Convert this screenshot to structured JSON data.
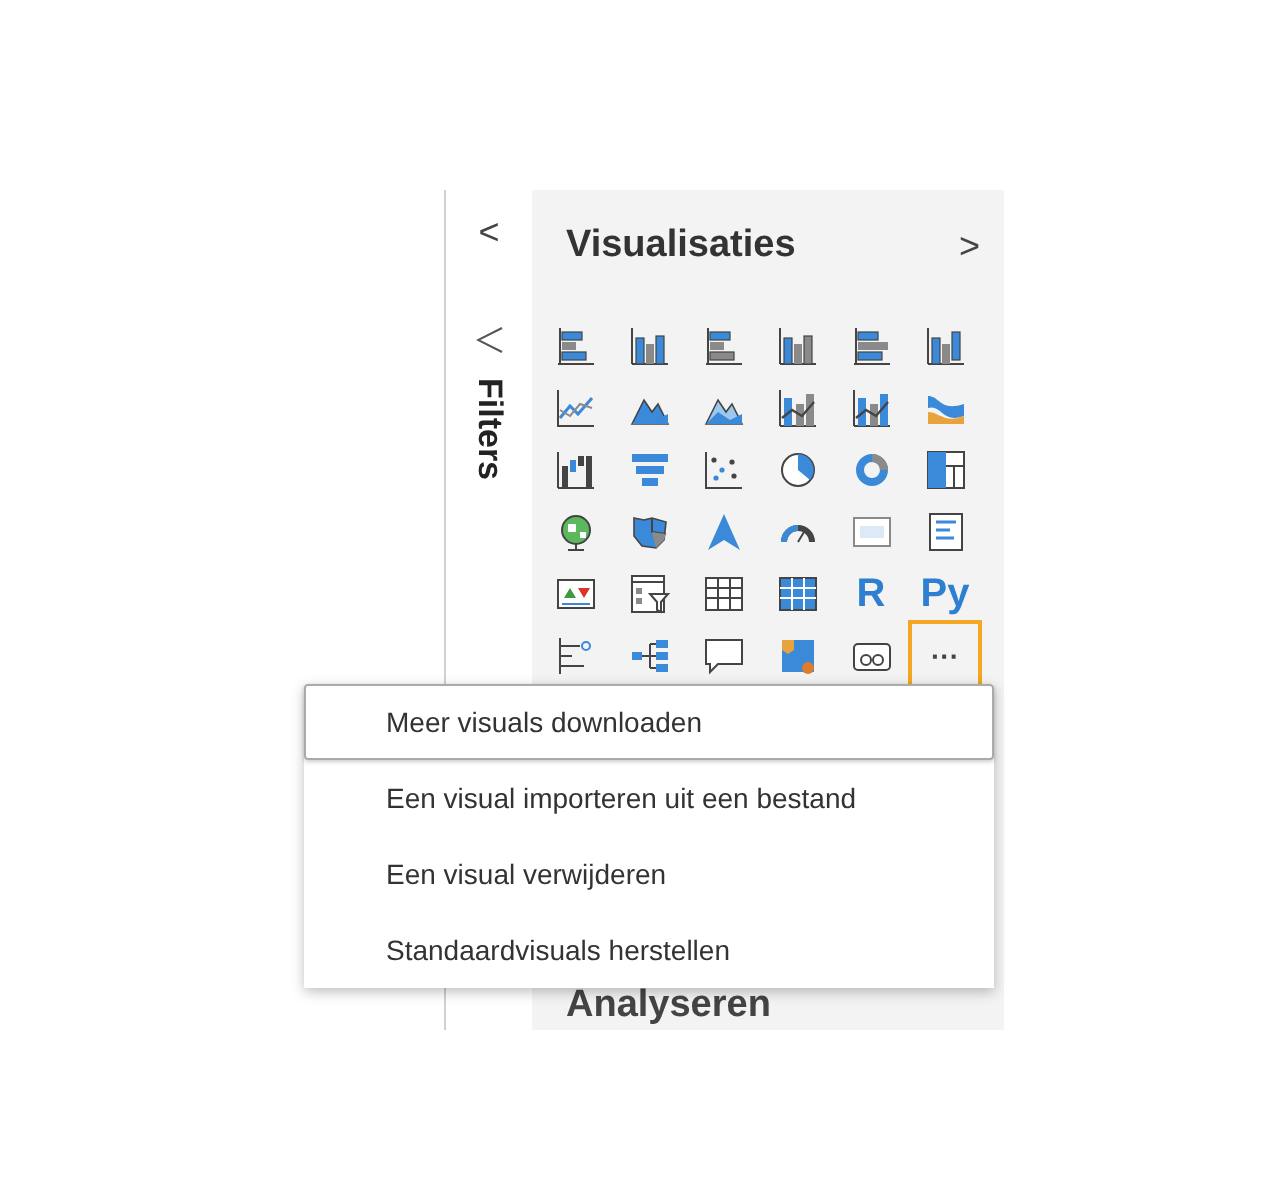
{
  "filters_strip": {
    "collapse_glyph": "<",
    "label": "Filters"
  },
  "visualizations": {
    "title": "Visualisaties",
    "expand_glyph": ">",
    "items": [
      {
        "kind": "hbar-stacked",
        "selected": false
      },
      {
        "kind": "column-stacked",
        "selected": false
      },
      {
        "kind": "hbar-clustered",
        "selected": false
      },
      {
        "kind": "column-clustered",
        "selected": false
      },
      {
        "kind": "hbar-full",
        "selected": false
      },
      {
        "kind": "column-full",
        "selected": false
      },
      {
        "kind": "line",
        "selected": false
      },
      {
        "kind": "area",
        "selected": false
      },
      {
        "kind": "area-stacked",
        "selected": false
      },
      {
        "kind": "combo",
        "selected": false
      },
      {
        "kind": "combo-clustered",
        "selected": false
      },
      {
        "kind": "ribbon",
        "selected": false
      },
      {
        "kind": "waterfall",
        "selected": false
      },
      {
        "kind": "funnel",
        "selected": false
      },
      {
        "kind": "scatter",
        "selected": false
      },
      {
        "kind": "pie",
        "selected": false
      },
      {
        "kind": "donut",
        "selected": false
      },
      {
        "kind": "treemap",
        "selected": false
      },
      {
        "kind": "globe",
        "selected": false
      },
      {
        "kind": "map",
        "selected": false
      },
      {
        "kind": "arrow",
        "selected": false
      },
      {
        "kind": "gauge",
        "selected": false
      },
      {
        "kind": "card",
        "selected": false
      },
      {
        "kind": "list",
        "selected": false
      },
      {
        "kind": "kpi",
        "selected": false
      },
      {
        "kind": "slicer",
        "selected": false
      },
      {
        "kind": "table",
        "selected": false
      },
      {
        "kind": "matrix",
        "selected": false
      },
      {
        "kind": "text",
        "label": "R",
        "selected": false
      },
      {
        "kind": "text",
        "label": "Py",
        "selected": false
      },
      {
        "kind": "influencers",
        "selected": false
      },
      {
        "kind": "decomposition",
        "selected": false
      },
      {
        "kind": "chat",
        "selected": false
      },
      {
        "kind": "paginated",
        "selected": false
      },
      {
        "kind": "power-apps",
        "selected": false
      },
      {
        "kind": "text",
        "label": "···",
        "selected": true
      }
    ]
  },
  "menu": {
    "items": [
      {
        "label": "Meer visuals downloaden",
        "selected": true
      },
      {
        "label": "Een visual importeren uit een bestand",
        "selected": false
      },
      {
        "label": "Een visual verwijderen",
        "selected": false
      },
      {
        "label": "Standaardvisuals herstellen",
        "selected": false
      }
    ]
  },
  "section_below": {
    "title": "Analyseren"
  }
}
